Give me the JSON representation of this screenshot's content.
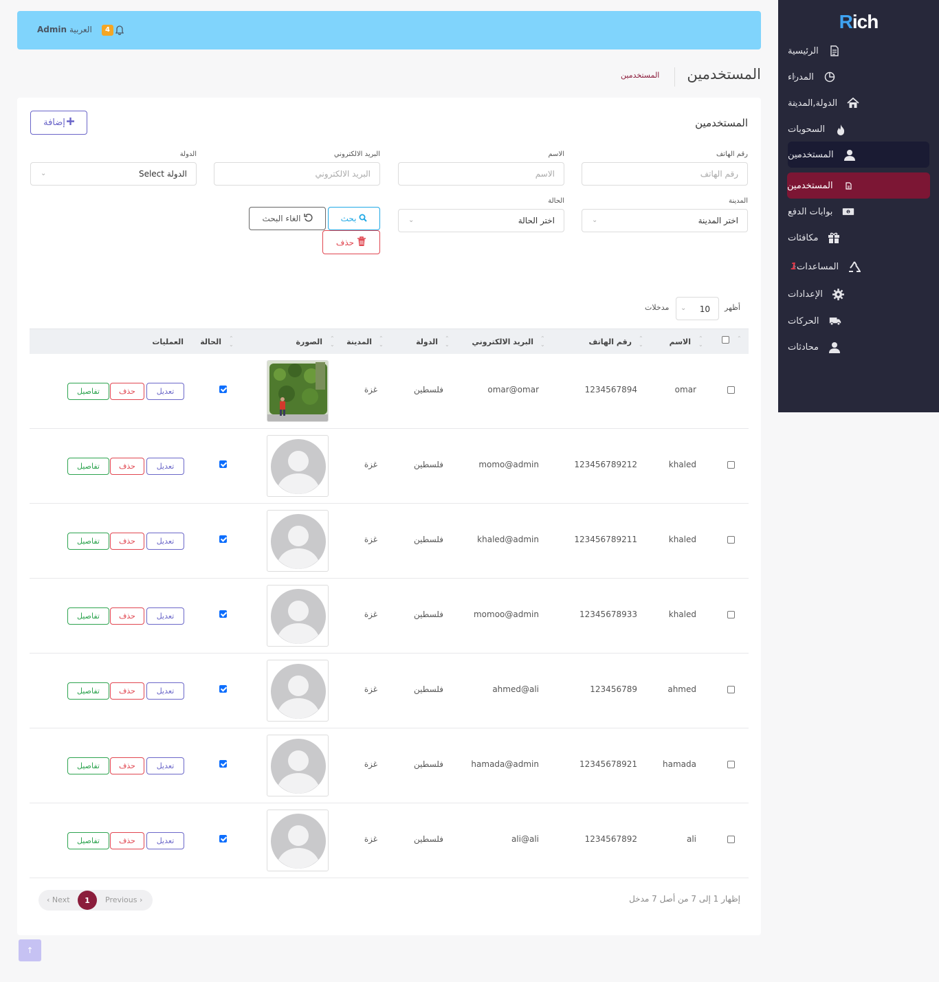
{
  "brand": {
    "logo_r": "R",
    "logo_rest": "ich"
  },
  "topbar": {
    "admin": "Admin",
    "language": "العربية",
    "notifications": "4"
  },
  "sidebar": {
    "items": [
      {
        "label": "الرئيسية",
        "icon": "document-icon"
      },
      {
        "label": "المدراء",
        "icon": "pie-chart-icon"
      },
      {
        "label": "الدولة,المدينة",
        "icon": "home-icon"
      },
      {
        "label": "السحوبات",
        "icon": "fire-icon"
      },
      {
        "label": "المستخدمين",
        "icon": "user-icon"
      },
      {
        "label": "المستخدمين",
        "icon": "file-icon"
      },
      {
        "label": "بوابات الدفع",
        "icon": "money-icon"
      },
      {
        "label": "مكافئات",
        "icon": "gift-icon"
      },
      {
        "label": "المساعدات",
        "icon": "recycle-icon",
        "badge": "1"
      },
      {
        "label": "الإعدادات",
        "icon": "gear-icon"
      },
      {
        "label": "الحركات",
        "icon": "truck-icon"
      },
      {
        "label": "محادثات",
        "icon": "user-icon"
      }
    ]
  },
  "page": {
    "title": "المستخدمين",
    "breadcrumb": "المستخدمين"
  },
  "card": {
    "title": "المستخدمين",
    "add_label": "إضافة"
  },
  "filters": {
    "phone": {
      "label": "رقم الهاتف",
      "placeholder": "رقم الهاتف"
    },
    "name": {
      "label": "الاسم",
      "placeholder": "الاسم"
    },
    "email": {
      "label": "البريد الالكتروني",
      "placeholder": "البريد الالكتروني"
    },
    "country": {
      "label": "الدولة",
      "value": "Select الدولة"
    },
    "city": {
      "label": "المدينة",
      "value": "اختر المدينة"
    },
    "status": {
      "label": "الحالة",
      "value": "اختر الحالة"
    },
    "search_label": "بحث",
    "cancel_label": "الغاء البحث",
    "delete_label": "حذف"
  },
  "length": {
    "show": "أظهر",
    "value": "10",
    "entries": "مدخلات"
  },
  "table": {
    "headers": {
      "name": "الاسم",
      "phone": "رقم الهاتف",
      "email": "البريد الالكتروني",
      "country": "الدولة",
      "city": "المدينة",
      "photo": "الصورة",
      "status": "الحالة",
      "actions": "العمليات"
    },
    "actions": {
      "edit": "تعديل",
      "delete": "حذف",
      "details": "تفاصيل"
    },
    "rows": [
      {
        "name": "omar",
        "phone": "1234567894",
        "email": "omar@omar",
        "country": "فلسطين",
        "city": "غزة",
        "photo": "custom",
        "active": true
      },
      {
        "name": "khaled",
        "phone": "123456789212",
        "email": "momo@admin",
        "country": "فلسطين",
        "city": "غزة",
        "photo": "default",
        "active": true
      },
      {
        "name": "khaled",
        "phone": "123456789211",
        "email": "khaled@admin",
        "country": "فلسطين",
        "city": "غزة",
        "photo": "default",
        "active": true
      },
      {
        "name": "khaled",
        "phone": "12345678933",
        "email": "momoo@admin",
        "country": "فلسطين",
        "city": "غزة",
        "photo": "default",
        "active": true
      },
      {
        "name": "ahmed",
        "phone": "123456789",
        "email": "ahmed@ali",
        "country": "فلسطين",
        "city": "غزة",
        "photo": "default",
        "active": true
      },
      {
        "name": "hamada",
        "phone": "12345678921",
        "email": "hamada@admin",
        "country": "فلسطين",
        "city": "غزة",
        "photo": "default",
        "active": true
      },
      {
        "name": "ali",
        "phone": "1234567892",
        "email": "ali@ali",
        "country": "فلسطين",
        "city": "غزة",
        "photo": "default",
        "active": true
      }
    ]
  },
  "pagination": {
    "info": "إظهار 1 إلى 7 من أصل 7 مدخل",
    "next": "Next",
    "previous": "Previous",
    "current": "1"
  },
  "colors": {
    "sidebar": "#27283a",
    "accent": "#8b1d3c",
    "topbar": "#80d4fc"
  }
}
